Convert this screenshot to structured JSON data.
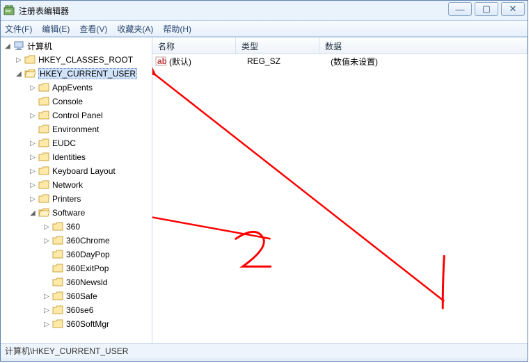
{
  "window": {
    "title": "注册表编辑器"
  },
  "menu": {
    "file": "文件(F)",
    "edit": "编辑(E)",
    "view": "查看(V)",
    "favorites": "收藏夹(A)",
    "help": "帮助(H)"
  },
  "win_controls": {
    "minimize": "—",
    "maximize": "▢",
    "close": "✕"
  },
  "tree": {
    "root": "计算机",
    "hkcr": "HKEY_CLASSES_ROOT",
    "hkcu": "HKEY_CURRENT_USER",
    "children": [
      {
        "label": "AppEvents",
        "toggle": "▷"
      },
      {
        "label": "Console",
        "toggle": ""
      },
      {
        "label": "Control Panel",
        "toggle": "▷"
      },
      {
        "label": "Environment",
        "toggle": ""
      },
      {
        "label": "EUDC",
        "toggle": "▷"
      },
      {
        "label": "Identities",
        "toggle": "▷"
      },
      {
        "label": "Keyboard Layout",
        "toggle": "▷"
      },
      {
        "label": "Network",
        "toggle": "▷"
      },
      {
        "label": "Printers",
        "toggle": "▷"
      },
      {
        "label": "Software",
        "toggle": "◢"
      }
    ],
    "software_children": [
      "360",
      "360Chrome",
      "360DayPop",
      "360ExitPop",
      "360Newsld",
      "360Safe",
      "360se6",
      "360SoftMgr"
    ]
  },
  "list": {
    "headers": {
      "name": "名称",
      "type": "类型",
      "data": "数据"
    },
    "row": {
      "name": "(默认)",
      "type": "REG_SZ",
      "data": "(数值未设置)"
    }
  },
  "statusbar": {
    "path": "计算机\\HKEY_CURRENT_USER"
  },
  "annotations": {
    "label1": "1",
    "label2": "2"
  }
}
